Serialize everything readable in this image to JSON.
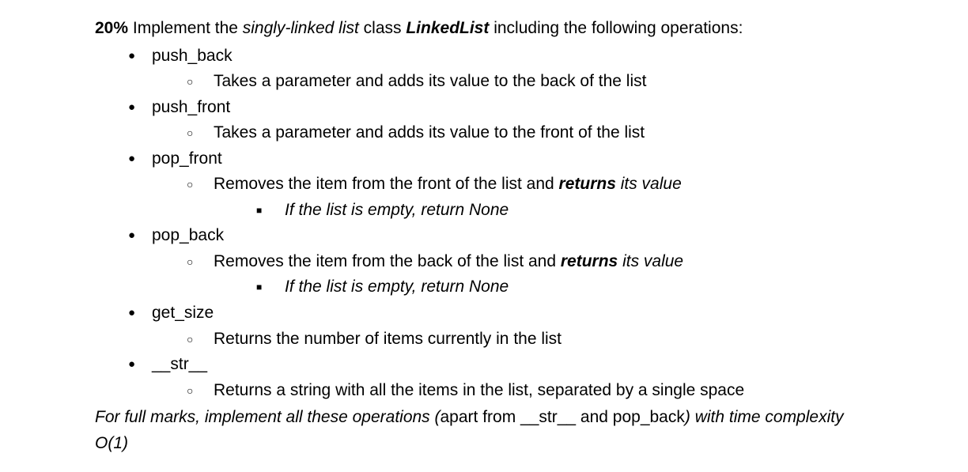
{
  "intro": {
    "weight": "20%",
    "pre": " Implement the ",
    "em1": "singly-linked list",
    "mid": " class ",
    "em2": "LinkedList",
    "post": " including the following operations:"
  },
  "ops": [
    {
      "name": "push_back",
      "subs": [
        {
          "parts": [
            {
              "t": "Takes a parameter and adds its value to the back of the list"
            }
          ]
        }
      ]
    },
    {
      "name": "push_front",
      "subs": [
        {
          "parts": [
            {
              "t": "Takes a parameter and adds its value to the front of the list"
            }
          ]
        }
      ]
    },
    {
      "name": "pop_front",
      "subs": [
        {
          "parts": [
            {
              "t": "Removes the item from the front of the list and "
            },
            {
              "t": "returns",
              "cls": "bold-italic"
            },
            {
              "t": " its value",
              "cls": "italic"
            }
          ],
          "subsubs": [
            {
              "parts": [
                {
                  "t": "If the list is empty, return None",
                  "cls": "italic"
                }
              ]
            }
          ]
        }
      ]
    },
    {
      "name": "pop_back",
      "subs": [
        {
          "parts": [
            {
              "t": "Removes the item from the back of the list and "
            },
            {
              "t": "returns",
              "cls": "bold-italic"
            },
            {
              "t": " its value",
              "cls": "italic"
            }
          ],
          "subsubs": [
            {
              "parts": [
                {
                  "t": "If the list is empty, return None",
                  "cls": "italic"
                }
              ]
            }
          ]
        }
      ]
    },
    {
      "name": "get_size",
      "subs": [
        {
          "parts": [
            {
              "t": "Returns the number of items currently in the list"
            }
          ]
        }
      ]
    },
    {
      "name": "__str__",
      "subs": [
        {
          "parts": [
            {
              "t": "Returns a string with all the items in the list, separated by a single space"
            }
          ]
        }
      ]
    }
  ],
  "footnote": {
    "p1": "For full marks, implement all these operations (",
    "plain": "apart from __str__ and pop_back",
    "p2": ") with time complexity O(1)"
  }
}
